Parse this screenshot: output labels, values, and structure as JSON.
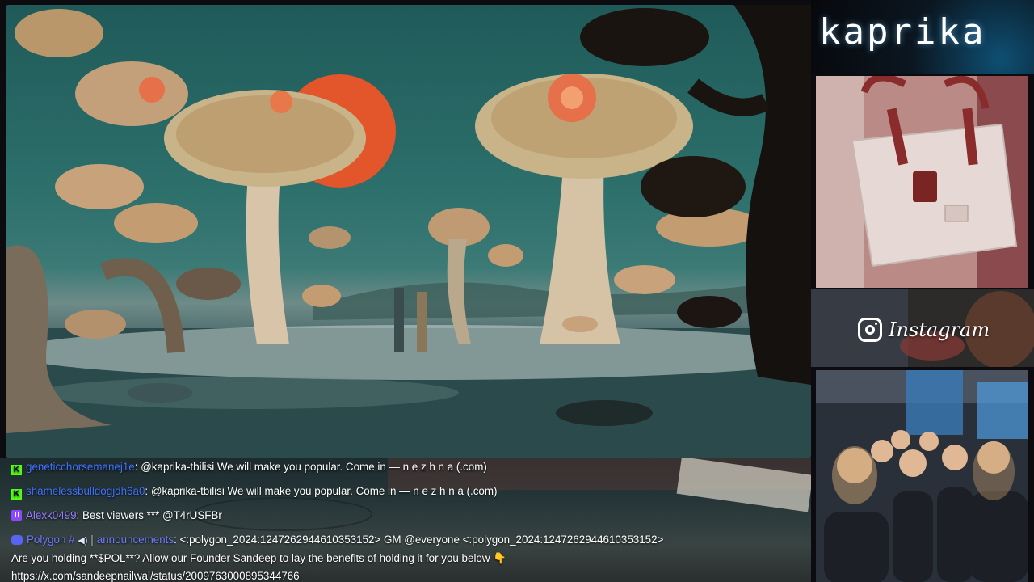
{
  "brand": {
    "title": "kaprika"
  },
  "instagram": {
    "label": "Instagram",
    "icon": "instagram-icon"
  },
  "panels": {
    "scene": "mushroom-landscape-artwork",
    "bag": "handbag-photo",
    "team": "team-group-photo"
  },
  "chat": {
    "messages": [
      {
        "platform": "kick",
        "badge_icon": "kick-icon",
        "user": "geneticchorsemanej1e",
        "text": "@kaprika-tbilisi We will make you popular. Come in — n e z h n a (.com)"
      },
      {
        "platform": "kick",
        "badge_icon": "kick-icon",
        "user": "shamelessbulldogjdh6a0",
        "text": "@kaprika-tbilisi We will make you popular. Come in — n e z h n a (.com)"
      },
      {
        "platform": "twitch",
        "badge_icon": "twitch-icon",
        "user": "Alexk0499",
        "text": "Best viewers *** @T4rUSFBr"
      },
      {
        "platform": "discord",
        "badge_icon": "discord-icon",
        "user": "Polygon #",
        "channel": "announcements",
        "text": "<:polygon_2024:1247262944610353152> GM @everyone <:polygon_2024:1247262944610353152>",
        "line2": "Are you holding **$POL**? Allow our Founder Sandeep to lay the benefits of holding it for you below 👇",
        "line3": "https://x.com/sandeepnailwal/status/2009763000895344766"
      }
    ]
  },
  "colors": {
    "kick": "#53fc18",
    "twitch": "#9146ff",
    "discord": "#5865f2",
    "username": "#3f72ff"
  }
}
